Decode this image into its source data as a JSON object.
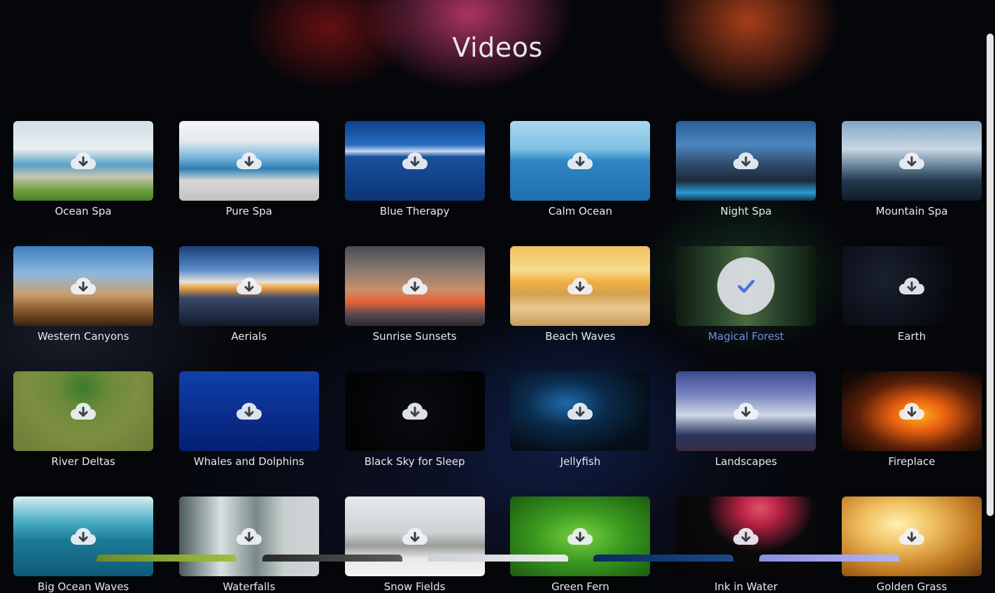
{
  "page": {
    "title": "Videos"
  },
  "icons": {
    "download": "cloud-download-icon",
    "selected": "checkmark-icon"
  },
  "colors": {
    "selected_label": "#6f8cf0",
    "label": "#e8e8ee",
    "background": "#05060a"
  },
  "videos": [
    {
      "label": "Ocean Spa",
      "bg": "linear-gradient(180deg,#cfdfe8 0%,#e9eef0 35%,#5aa0c8 55%,#c8c4b0 70%,#6a9c3a 88%,#4e7d2a 100%)",
      "selected": false
    },
    {
      "label": "Pure Spa",
      "bg": "linear-gradient(180deg,#f2f3f5 0%,#e6eaee 25%,#7db7dc 45%,#2e7fb4 60%,#d8d8d8 75%,#c2c2c2 100%)",
      "selected": false
    },
    {
      "label": "Blue Therapy",
      "bg": "linear-gradient(180deg,#0d3f8a 0%,#2a6cc0 30%,#c6d9ec 38%,#1a4f9e 45%,#0b3575 100%)",
      "selected": false
    },
    {
      "label": "Calm Ocean",
      "bg": "linear-gradient(180deg,#a9d8ee 0%,#7fc0e4 35%,#2f86c2 50%,#1f6fae 100%)",
      "selected": false
    },
    {
      "label": "Night Spa",
      "bg": "linear-gradient(180deg,#2a5d95 0%,#4d86c0 30%,#2f4a6a 55%,#1c2a3a 75%,#2a9bd0 90%,#17324c 100%)",
      "selected": false
    },
    {
      "label": "Mountain Spa",
      "bg": "linear-gradient(180deg,#7ea6c6 0%,#c9d7e2 35%,#6c88a0 55%,#22384e 75%,#101c28 100%)",
      "selected": false
    },
    {
      "label": "Western Canyons",
      "bg": "linear-gradient(180deg,#3f7fc0 0%,#8fb8dc 35%,#c8a070 60%,#8a5a2c 80%,#3a2410 100%)",
      "selected": false
    },
    {
      "label": "Aerials",
      "bg": "linear-gradient(180deg,#1b3f78 0%,#5a8ccc 30%,#e8e2d8 45%,#f0a040 52%,#3a4a68 65%,#101a2c 100%)",
      "selected": false
    },
    {
      "label": "Sunrise Sunsets",
      "bg": "linear-gradient(180deg,#4a4a58 0%,#8a7a70 30%,#c8906a 55%,#e8603a 70%,#5a4a50 85%,#2e2a30 100%)",
      "selected": false
    },
    {
      "label": "Beach Waves",
      "bg": "linear-gradient(180deg,#f2c060 0%,#f8dc90 30%,#f0b040 45%,#d4a050 60%,#e8c890 78%,#c89a58 100%)",
      "selected": false
    },
    {
      "label": "Magical Forest",
      "bg": "linear-gradient(90deg,#0f1a10 0%,#27402a 25%,#4c6a3e 50%,#26402a 75%,#0e1a10 100%)",
      "selected": true
    },
    {
      "label": "Earth",
      "bg": "radial-gradient(circle at 30% 40%, #1a2030 0%, #05070c 70%)",
      "selected": false
    },
    {
      "label": "River Deltas",
      "bg": "radial-gradient(ellipse at 50% 20%, #3a7a2a 0%, #6a8a3a 25%, #7e8e40 55%, #6a7d38 100%)",
      "selected": false
    },
    {
      "label": "Whales and Dolphins",
      "bg": "linear-gradient(180deg,#1040a8 0%,#0a2f90 50%,#062070 100%)",
      "selected": false
    },
    {
      "label": "Black Sky for Sleep",
      "bg": "radial-gradient(circle at 50% 50%, #0a0c12 0%, #020304 80%)",
      "selected": false
    },
    {
      "label": "Jellyfish",
      "bg": "radial-gradient(ellipse at 40% 40%, #1e6aa8 0%, #0a2a4a 35%, #060e18 75%)",
      "selected": false
    },
    {
      "label": "Landscapes",
      "bg": "linear-gradient(180deg,#3a4a90 0%,#7a86c0 30%,#cfd6e6 55%,#8a96b0 65%,#2a3660 80%,#3a2a40 100%)",
      "selected": false
    },
    {
      "label": "Fireplace",
      "bg": "radial-gradient(ellipse at 55% 55%, #ffb020 0%, #e86010 25%, #5a2008 55%, #120806 85%)",
      "selected": false
    },
    {
      "label": "Big Ocean Waves",
      "bg": "linear-gradient(180deg,#d8eef2 0%,#4fb0c8 30%,#1c7a96 55%,#0e5a78 100%)",
      "selected": false
    },
    {
      "label": "Waterfalls",
      "bg": "linear-gradient(90deg,#4a5a5a 0%,#d8e0e2 30%,#7a8a88 55%,#c8cfcf 75%,#d0d4d6 100%)",
      "selected": false
    },
    {
      "label": "Snow Fields",
      "bg": "linear-gradient(180deg,#e6e8ea 0%,#cfd2d4 45%,#9a9c98 62%,#e8eae8 78%,#f4f4f4 100%)",
      "selected": false
    },
    {
      "label": "Green Fern",
      "bg": "radial-gradient(ellipse at 50% 50%, #7ad040 0%, #3a9a20 45%, #1c5a10 100%)",
      "selected": false
    },
    {
      "label": "Ink in Water",
      "bg": "radial-gradient(ellipse at 60% 15%, #e2506a 0%, #b02040 18%, #0a0a0c 45%, #050506 100%)",
      "selected": false
    },
    {
      "label": "Golden Grass",
      "bg": "radial-gradient(ellipse at 40% 35%, #fff0b0 0%, #f0c060 30%, #c07820 65%, #6a3a10 100%)",
      "selected": false
    }
  ],
  "next_row_peek": [
    {
      "bg": "linear-gradient(90deg,#6a8a2a,#a0c040)"
    },
    {
      "bg": "linear-gradient(90deg,#2a2a2a,#5a5a5a)"
    },
    {
      "bg": "linear-gradient(90deg,#cfd2d6,#e8eaee)"
    },
    {
      "bg": "linear-gradient(90deg,#0a2a5a,#1a4a8a)"
    },
    {
      "bg": "linear-gradient(90deg,#8a90e0,#b0b4f0)"
    }
  ]
}
